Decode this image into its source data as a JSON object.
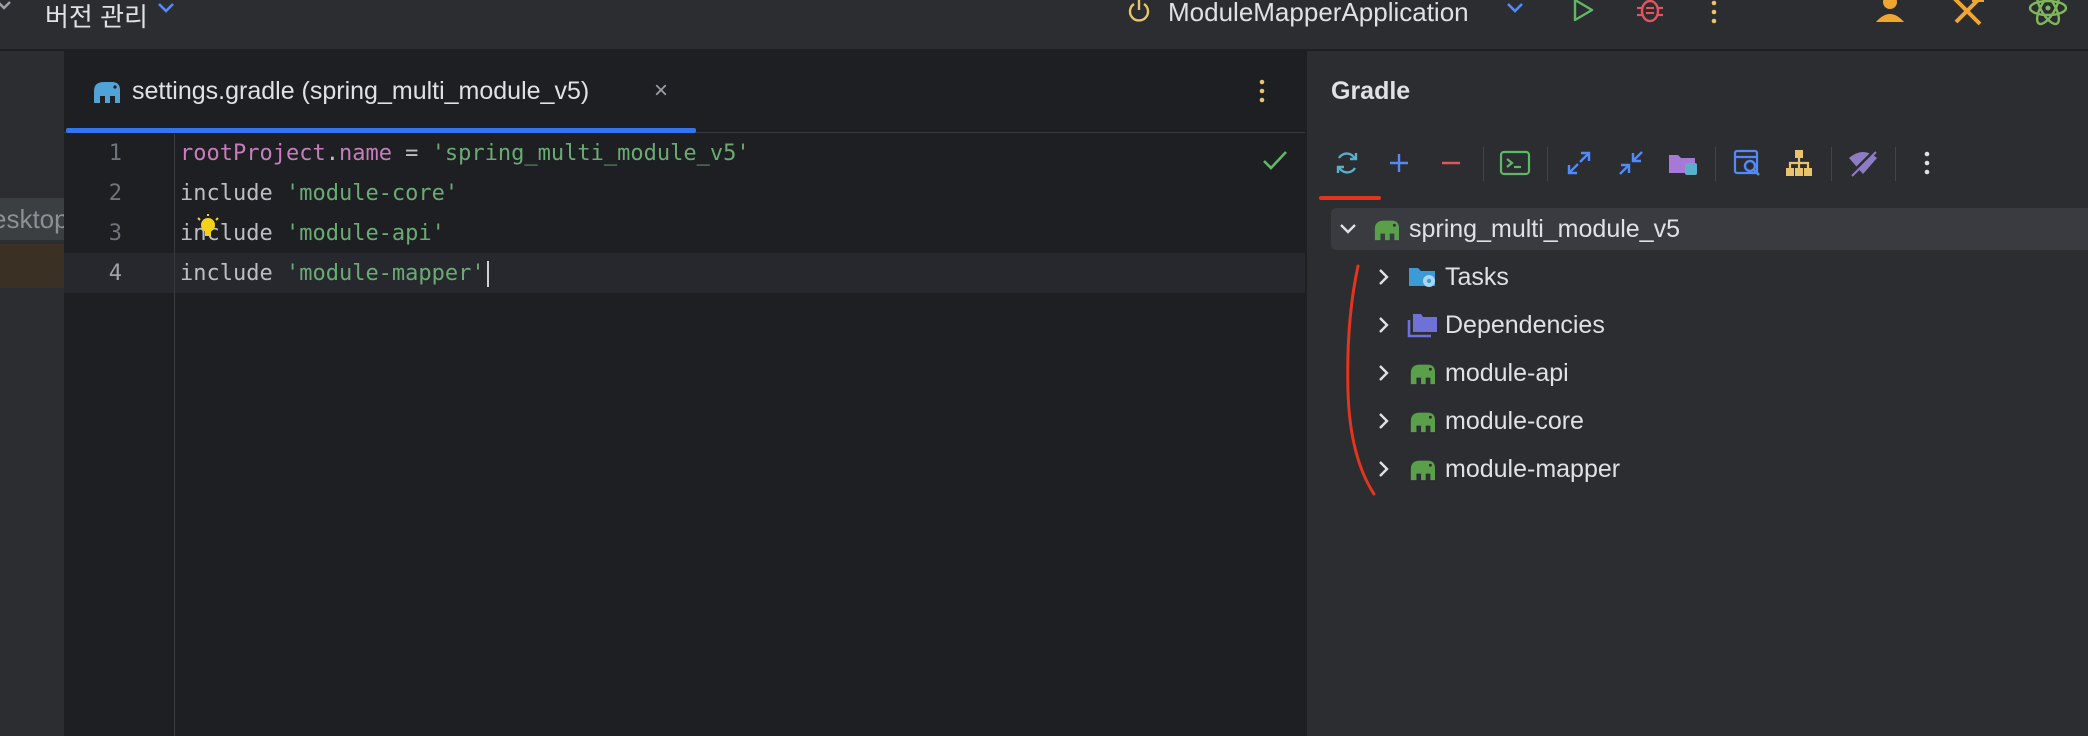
{
  "topbar": {
    "vcs_label": "버전 관리",
    "run_config": "ModuleMapperApplication"
  },
  "left_strip": {
    "chip_text": "esktop"
  },
  "editor": {
    "tab_title": "settings.gradle (spring_multi_module_v5)",
    "tab_close": "×",
    "lines": [
      {
        "num": "1",
        "parts": [
          {
            "t": "rootProject",
            "c": "kw-prop"
          },
          {
            "t": ".",
            "c": "op"
          },
          {
            "t": "name",
            "c": "kw-attr"
          },
          {
            "t": " = ",
            "c": "op"
          },
          {
            "t": "'spring_multi_module_v5'",
            "c": "str"
          }
        ]
      },
      {
        "num": "2",
        "parts": [
          {
            "t": "include ",
            "c": "plain"
          },
          {
            "t": "'module-core'",
            "c": "str"
          }
        ]
      },
      {
        "num": "3",
        "parts": [
          {
            "t": "include ",
            "c": "plain"
          },
          {
            "t": "'module-api'",
            "c": "str"
          }
        ]
      },
      {
        "num": "4",
        "parts": [
          {
            "t": "include ",
            "c": "plain"
          },
          {
            "t": "'module-mapper'",
            "c": "str"
          }
        ]
      }
    ]
  },
  "gradle": {
    "title": "Gradle",
    "toolbar": [
      "reload-icon",
      "plus-icon",
      "minus-icon",
      "terminal-icon",
      "expand-icon",
      "collapse-icon",
      "folder-link-icon",
      "analyze-icon",
      "hierarchy-icon",
      "offline-icon",
      "more-vertical-icon"
    ],
    "tree": {
      "root": "spring_multi_module_v5",
      "children": [
        "Tasks",
        "Dependencies",
        "module-api",
        "module-core",
        "module-mapper"
      ]
    }
  },
  "colors": {
    "accent": "#3574f0",
    "annotation": "#e3341e",
    "gradle_green": "#5aa04a",
    "string": "#6aab73",
    "keyword": "#c77dbb"
  }
}
